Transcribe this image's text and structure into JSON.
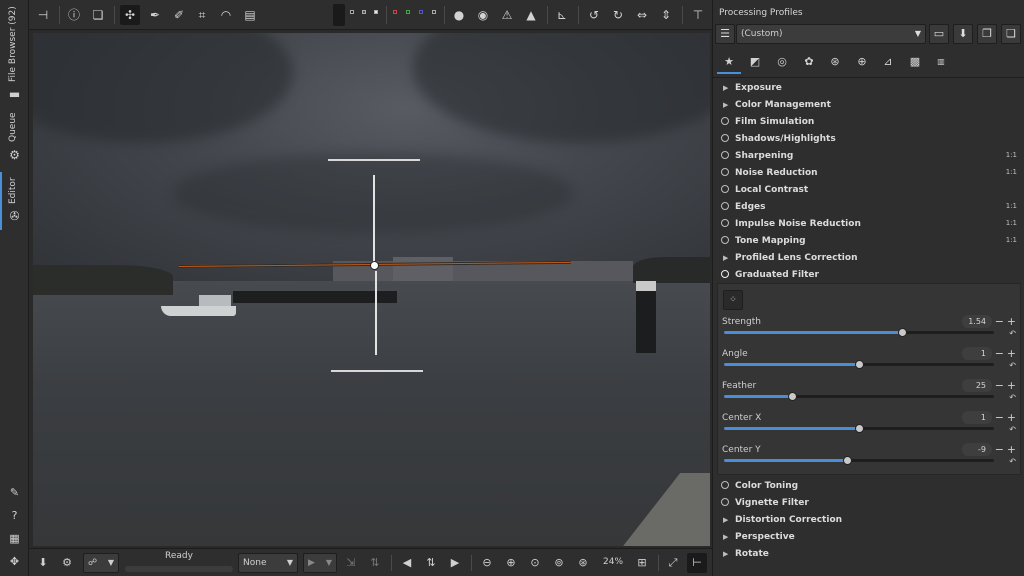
{
  "left_tabs": {
    "file_browser": "File Browser (92)",
    "queue": "Queue",
    "editor": "Editor"
  },
  "right_panel": {
    "title": "Processing Profiles",
    "profile_selected": "(Custom)",
    "tools": [
      {
        "label": "Exposure",
        "kind": "arrow"
      },
      {
        "label": "Color Management",
        "kind": "arrow"
      },
      {
        "label": "Film Simulation",
        "kind": "power"
      },
      {
        "label": "Shadows/Highlights",
        "kind": "power"
      },
      {
        "label": "Sharpening",
        "kind": "power",
        "badge": "1:1"
      },
      {
        "label": "Noise Reduction",
        "kind": "power",
        "badge": "1:1"
      },
      {
        "label": "Local Contrast",
        "kind": "power"
      },
      {
        "label": "Edges",
        "kind": "power",
        "badge": "1:1"
      },
      {
        "label": "Impulse Noise Reduction",
        "kind": "power",
        "badge": "1:1"
      },
      {
        "label": "Tone Mapping",
        "kind": "power",
        "badge": "1:1"
      },
      {
        "label": "Profiled Lens Correction",
        "kind": "arrow"
      },
      {
        "label": "Graduated Filter",
        "kind": "power-on"
      }
    ],
    "tools_after": [
      {
        "label": "Color Toning",
        "kind": "power"
      },
      {
        "label": "Vignette Filter",
        "kind": "power"
      },
      {
        "label": "Distortion Correction",
        "kind": "arrow"
      },
      {
        "label": "Perspective",
        "kind": "arrow"
      },
      {
        "label": "Rotate",
        "kind": "arrow"
      }
    ],
    "graduated_filter": {
      "params": [
        {
          "label": "Strength",
          "value": "1.54",
          "fraction": 0.66
        },
        {
          "label": "Angle",
          "value": "1",
          "fraction": 0.5
        },
        {
          "label": "Feather",
          "value": "25",
          "fraction": 0.25
        },
        {
          "label": "Center X",
          "value": "1",
          "fraction": 0.5
        },
        {
          "label": "Center Y",
          "value": "-9",
          "fraction": 0.455
        }
      ]
    }
  },
  "bottom_bar": {
    "status": "Ready",
    "preview_mode": "None",
    "zoom": "24%"
  }
}
